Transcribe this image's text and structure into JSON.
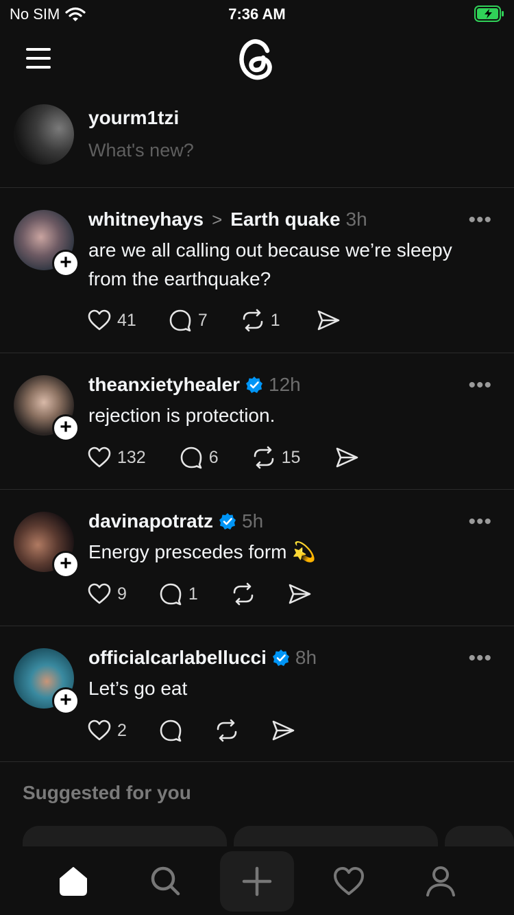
{
  "status_bar": {
    "carrier": "No SIM",
    "time": "7:36 AM"
  },
  "composer": {
    "username": "yourm1tzi",
    "placeholder": "What's new?"
  },
  "posts": [
    {
      "username": "whitneyhays",
      "topic_separator": ">",
      "topic": "Earth quake",
      "time": "3h",
      "verified": false,
      "text": "are we all calling out because we’re sleepy from the earthquake?",
      "likes": "41",
      "replies": "7",
      "reposts": "1",
      "more": "•••"
    },
    {
      "username": "theanxietyhealer",
      "time": "12h",
      "verified": true,
      "text": "rejection is protection.",
      "likes": "132",
      "replies": "6",
      "reposts": "15",
      "more": "•••"
    },
    {
      "username": "davinapotratz",
      "time": "5h",
      "verified": true,
      "text": "Energy prescedes form 💫",
      "likes": "9",
      "replies": "1",
      "reposts": "",
      "more": "•••"
    },
    {
      "username": "officialcarlabellucci",
      "time": "8h",
      "verified": true,
      "text": "Let’s go eat",
      "likes": "2",
      "replies": "",
      "reposts": "",
      "more": "•••"
    }
  ],
  "suggested": {
    "title": "Suggested for you"
  },
  "tab_bar": [
    "home-icon",
    "search-icon",
    "new-thread-icon",
    "activity-icon",
    "profile-icon"
  ],
  "colors": {
    "background": "#101010",
    "verified": "#0095f6",
    "battery": "#30d158"
  }
}
